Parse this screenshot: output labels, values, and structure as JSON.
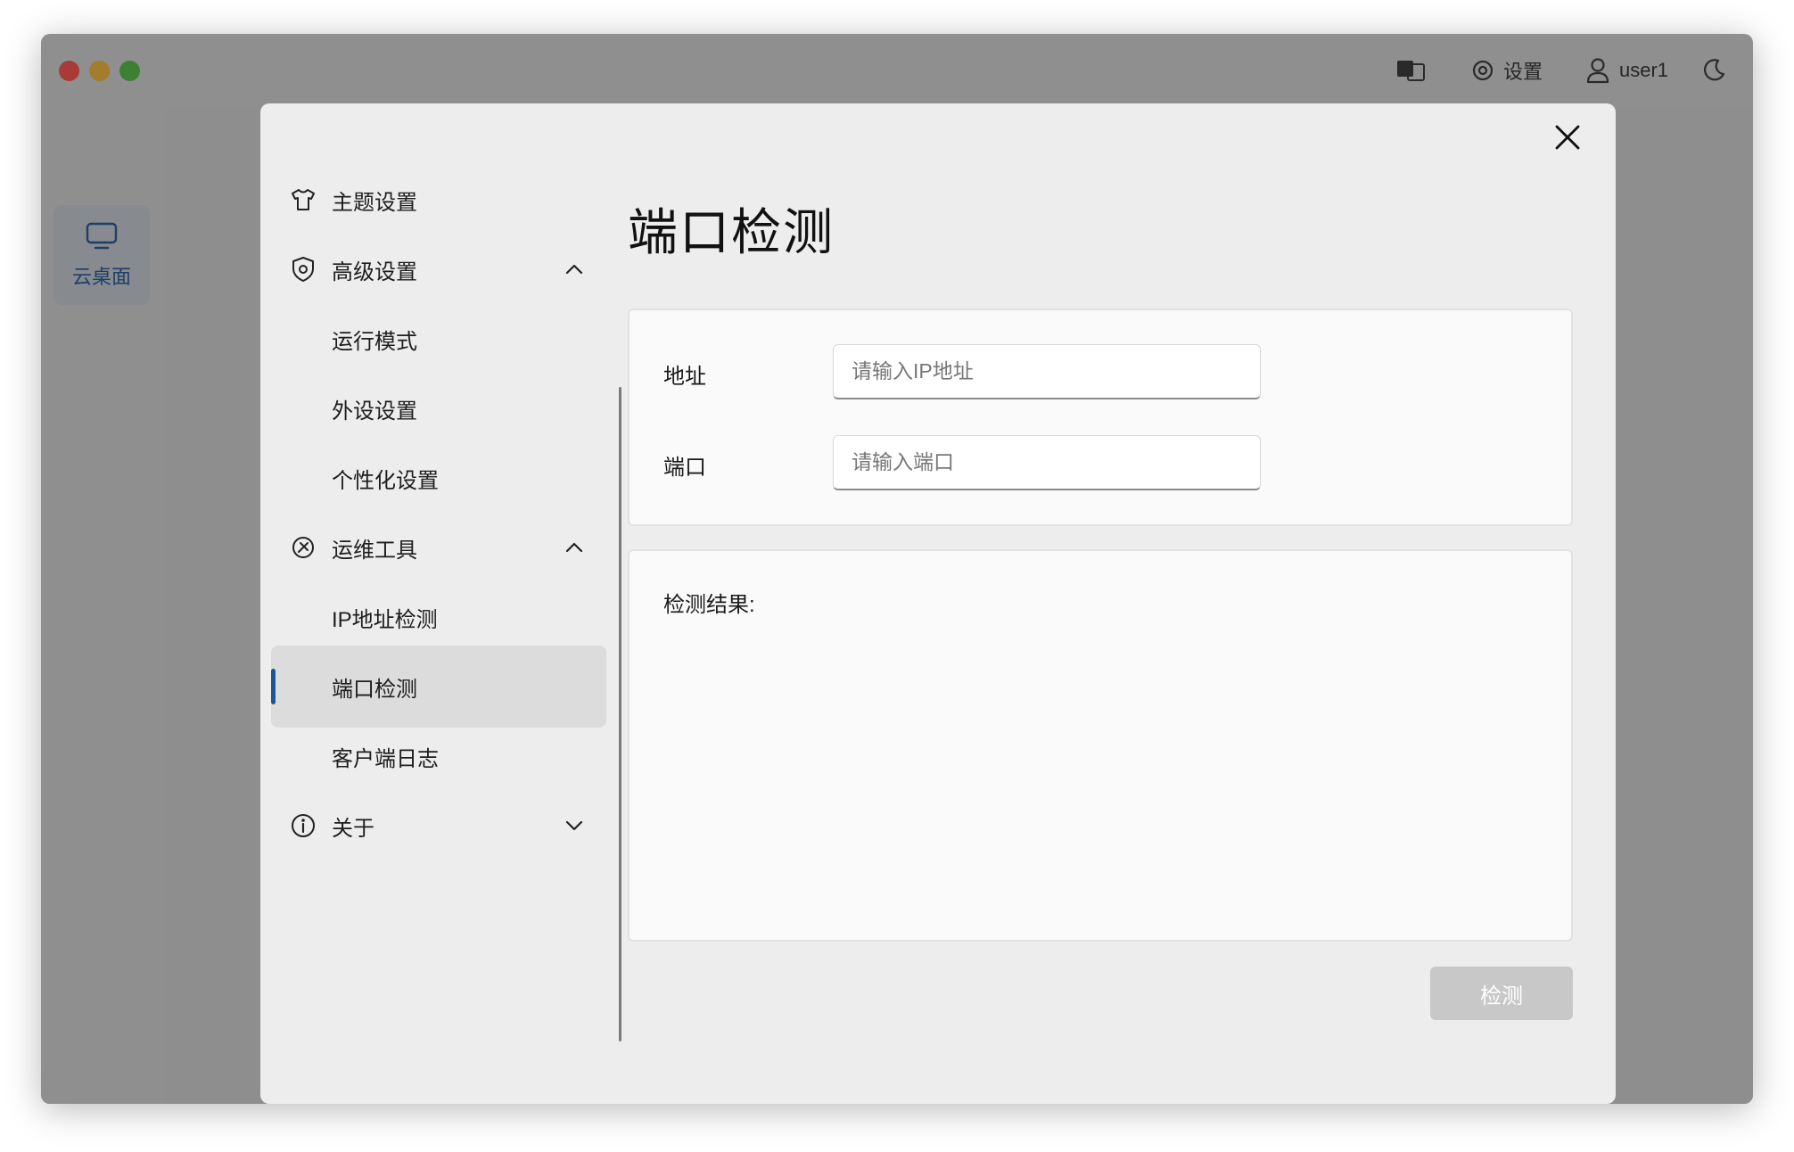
{
  "top_bar": {
    "settings_label": "设置",
    "user_label": "user1"
  },
  "rail": {
    "items": [
      {
        "label": "云桌面",
        "icon": "monitor-icon"
      }
    ]
  },
  "modal": {
    "nav": {
      "items": [
        {
          "label": "主题设置",
          "icon": "shirt-icon"
        },
        {
          "label": "高级设置",
          "icon": "shield-gear-icon",
          "expanded": true
        },
        {
          "label": "运行模式"
        },
        {
          "label": "外设设置"
        },
        {
          "label": "个性化设置"
        },
        {
          "label": "运维工具",
          "icon": "tools-icon",
          "expanded": true
        },
        {
          "label": "IP地址检测"
        },
        {
          "label": "端口检测",
          "active": true
        },
        {
          "label": "客户端日志"
        },
        {
          "label": "关于",
          "icon": "info-icon",
          "expanded": false
        }
      ]
    },
    "page_title": "端口检测",
    "form": {
      "address_label": "地址",
      "address_placeholder": "请输入IP地址",
      "port_label": "端口",
      "port_placeholder": "请输入端口"
    },
    "result": {
      "label": "检测结果:"
    },
    "check_button_label": "检测"
  },
  "colors": {
    "accent": "#1a5794",
    "overlay": "#8f8f8f",
    "modal_bg": "#ededed",
    "card_bg": "#fafafa",
    "disabled_button": "#c8c8c8"
  }
}
